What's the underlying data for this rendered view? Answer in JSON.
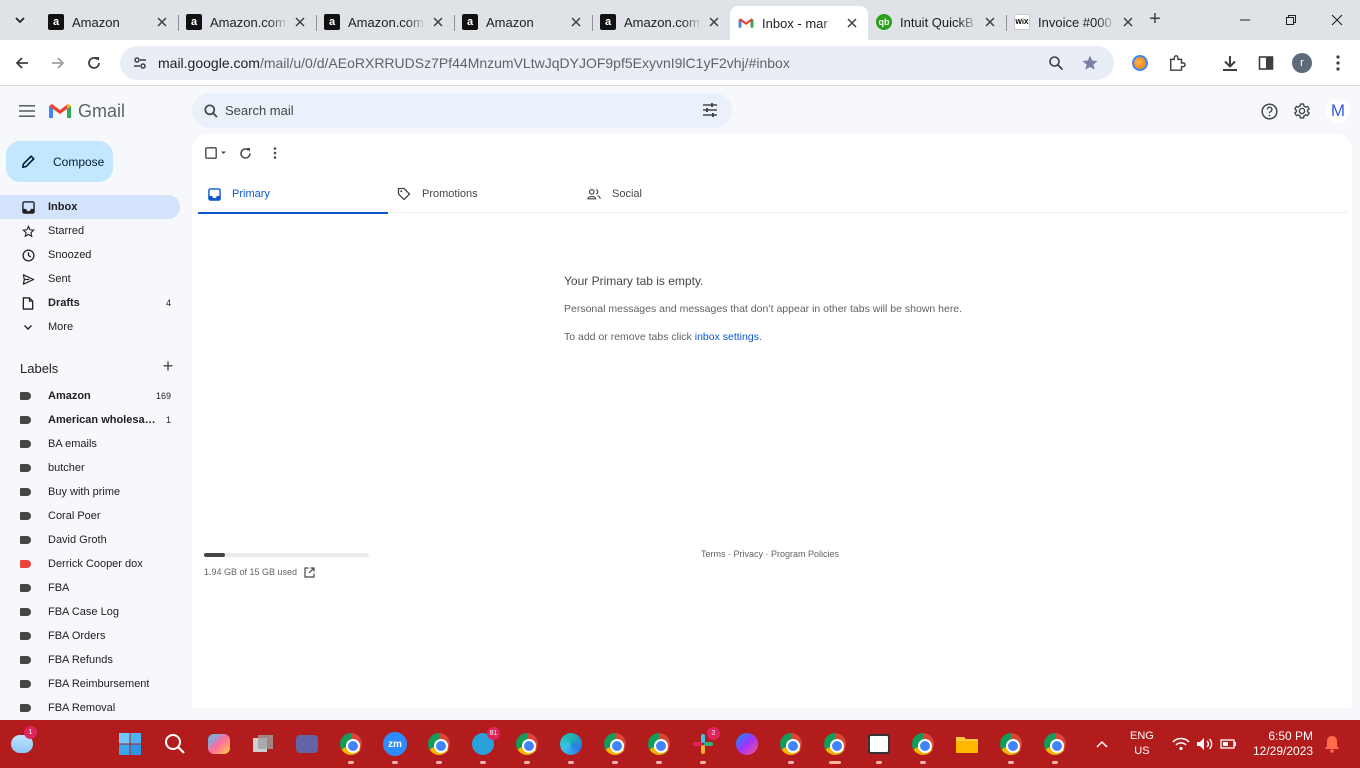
{
  "browser": {
    "tabs": [
      {
        "title": "Amazon",
        "favicon": "amazon-icon",
        "active": false
      },
      {
        "title": "Amazon.com",
        "favicon": "amazon-icon",
        "active": false
      },
      {
        "title": "Amazon.com",
        "favicon": "amazon-icon",
        "active": false
      },
      {
        "title": "Amazon",
        "favicon": "amazon-icon",
        "active": false
      },
      {
        "title": "Amazon.com",
        "favicon": "amazon-icon",
        "active": false
      },
      {
        "title": "Inbox - mar",
        "favicon": "gmail-icon",
        "active": true
      },
      {
        "title": "Intuit QuickB",
        "favicon": "quickbooks-icon",
        "active": false
      },
      {
        "title": "Invoice #000",
        "favicon": "wix-icon",
        "active": false
      }
    ],
    "url_host": "mail.google.com",
    "url_path": "/mail/u/0/d/AEoRXRRUDSz7Pf44MnzumVLtwJqDYJOF9pf5ExyvnI9lC1yF2vhj/#inbox",
    "profile_initial": "r"
  },
  "gmail": {
    "app_name": "Gmail",
    "search_placeholder": "Search mail",
    "account_initial": "M",
    "compose_label": "Compose",
    "nav": [
      {
        "label": "Inbox",
        "icon": "inbox-icon",
        "count": "",
        "active": true,
        "bold": true
      },
      {
        "label": "Starred",
        "icon": "star-icon",
        "count": "",
        "active": false,
        "bold": false
      },
      {
        "label": "Snoozed",
        "icon": "clock-icon",
        "count": "",
        "active": false,
        "bold": false
      },
      {
        "label": "Sent",
        "icon": "send-icon",
        "count": "",
        "active": false,
        "bold": false
      },
      {
        "label": "Drafts",
        "icon": "draft-icon",
        "count": "4",
        "active": false,
        "bold": true
      },
      {
        "label": "More",
        "icon": "chevron-down-icon",
        "count": "",
        "active": false,
        "bold": false
      }
    ],
    "labels_title": "Labels",
    "labels": [
      {
        "name": "Amazon",
        "count": "169",
        "bold": true,
        "color": "#444746"
      },
      {
        "name": "American wholesal...",
        "count": "1",
        "bold": true,
        "color": "#444746"
      },
      {
        "name": "BA emails",
        "count": "",
        "bold": false,
        "color": "#444746"
      },
      {
        "name": "butcher",
        "count": "",
        "bold": false,
        "color": "#444746"
      },
      {
        "name": "Buy with prime",
        "count": "",
        "bold": false,
        "color": "#444746"
      },
      {
        "name": "Coral Poer",
        "count": "",
        "bold": false,
        "color": "#444746"
      },
      {
        "name": "David Groth",
        "count": "",
        "bold": false,
        "color": "#444746"
      },
      {
        "name": "Derrick Cooper dox",
        "count": "",
        "bold": false,
        "color": "#e8453c"
      },
      {
        "name": "FBA",
        "count": "",
        "bold": false,
        "color": "#444746"
      },
      {
        "name": "FBA Case Log",
        "count": "",
        "bold": false,
        "color": "#444746"
      },
      {
        "name": "FBA Orders",
        "count": "",
        "bold": false,
        "color": "#444746"
      },
      {
        "name": "FBA Refunds",
        "count": "",
        "bold": false,
        "color": "#444746"
      },
      {
        "name": "FBA Reimbursement",
        "count": "",
        "bold": false,
        "color": "#444746"
      },
      {
        "name": "FBA Removal",
        "count": "",
        "bold": false,
        "color": "#444746"
      }
    ],
    "inbox_tabs": [
      {
        "label": "Primary",
        "icon": "inbox-icon",
        "active": true
      },
      {
        "label": "Promotions",
        "icon": "tag-icon",
        "active": false
      },
      {
        "label": "Social",
        "icon": "people-icon",
        "active": false
      }
    ],
    "empty_title": "Your Primary tab is empty.",
    "empty_line": "Personal messages and messages that don’t appear in other tabs will be shown here.",
    "empty_settings_prefix": "To add or remove tabs click ",
    "empty_settings_link": "inbox settings",
    "empty_settings_suffix": ".",
    "storage_text": "1.94 GB of 15 GB used",
    "storage_fraction": 0.13,
    "footer": "Terms · Privacy · Program Policies"
  },
  "taskbar": {
    "notification_badge": "1",
    "telegram_badge": "81",
    "slack_badge": "2",
    "language": "ENG",
    "region": "US",
    "time": "6:50 PM",
    "date": "12/29/2023",
    "accent": "#b31c1c"
  }
}
